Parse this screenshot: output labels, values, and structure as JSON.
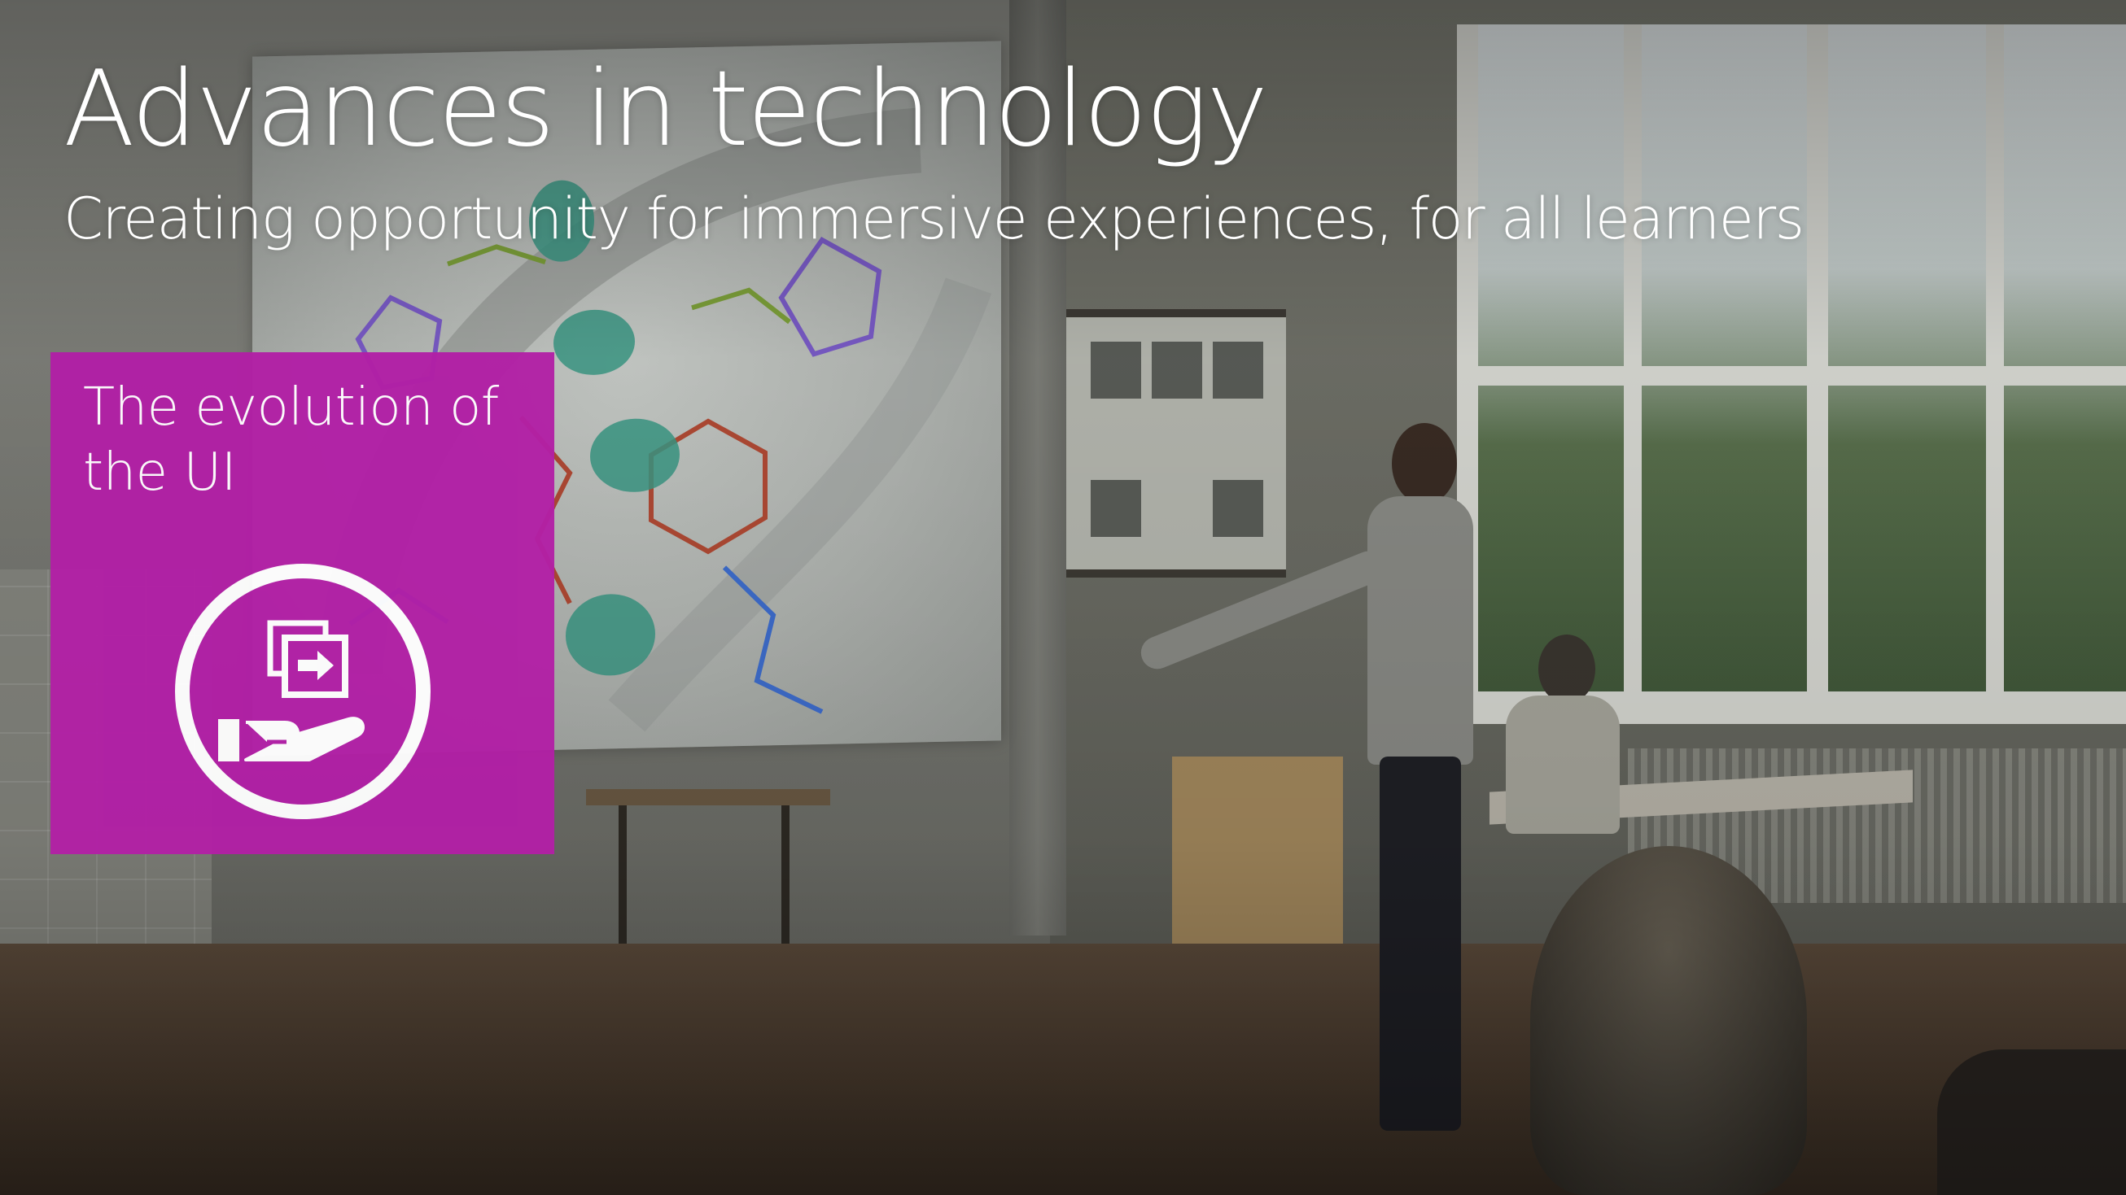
{
  "slide": {
    "title": "Advances in technology",
    "subtitle": "Creating opportunity for immersive experiences, for all learners"
  },
  "tile": {
    "label": "The evolution of the UI",
    "color": "#b21fa6",
    "icon": "hand-presenting-slide-icon"
  },
  "background": {
    "description_icon": "classroom-photo"
  }
}
